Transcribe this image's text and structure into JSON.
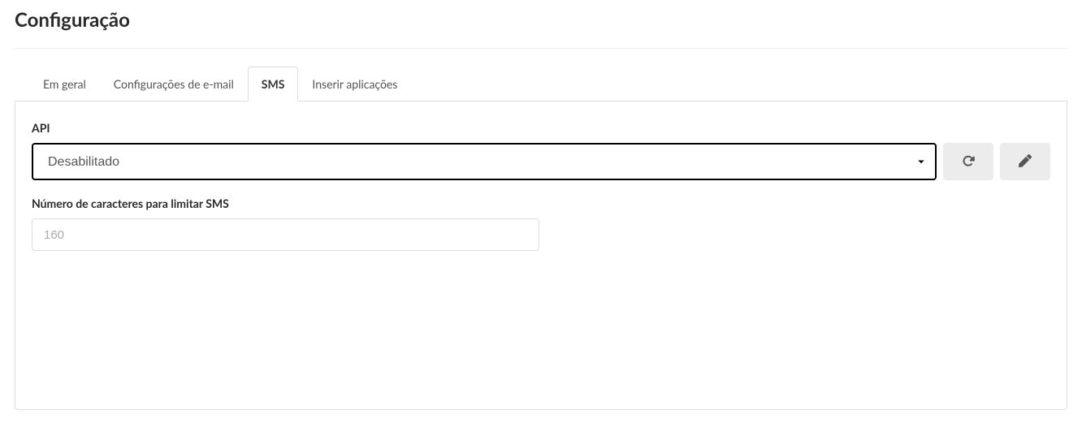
{
  "page": {
    "title": "Configuração"
  },
  "tabs": [
    {
      "label": "Em geral",
      "active": false
    },
    {
      "label": "Configurações de e-mail",
      "active": false
    },
    {
      "label": "SMS",
      "active": true
    },
    {
      "label": "Inserir aplicações",
      "active": false
    }
  ],
  "form": {
    "api": {
      "label": "API",
      "selected": "Desabilitado",
      "refreshIcon": "refresh-icon",
      "editIcon": "pencil-icon"
    },
    "sms_limit": {
      "label": "Número de caracteres para limitar SMS",
      "placeholder": "160",
      "value": ""
    }
  }
}
